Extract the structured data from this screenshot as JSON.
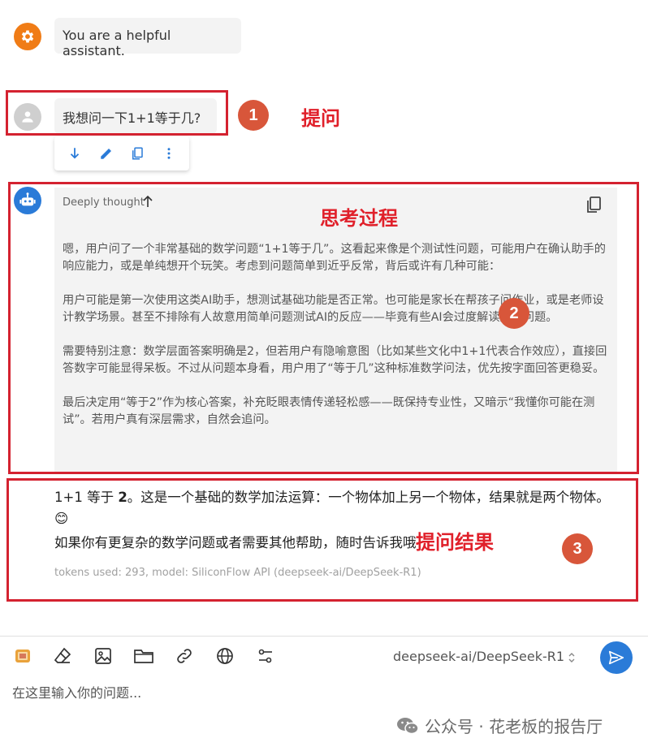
{
  "system_message": {
    "text": "You are a helpful assistant."
  },
  "user_message": {
    "text": "我想问一下1+1等于几?"
  },
  "annotations": {
    "num1": "1",
    "label1": "提问",
    "num2": "2",
    "label2": "思考过程",
    "num3": "3",
    "label3": "提问结果",
    "accent": "#d42230"
  },
  "message_toolbar": {
    "icons": [
      "arrow-down-icon",
      "pencil-icon",
      "copy-icon",
      "more-vert-icon"
    ]
  },
  "thinking": {
    "header": "Deeply thought",
    "paragraphs": [
      "嗯，用户问了一个非常基础的数学问题“1+1等于几”。这看起来像是个测试性问题，可能用户在确认助手的响应能力，或是单纯想开个玩笑。考虑到问题简单到近乎反常，背后或许有几种可能：",
      "用户可能是第一次使用这类AI助手，想测试基础功能是否正常。也可能是家长在帮孩子问作业，或是老师设计教学场景。甚至不排除有人故意用简单问题测试AI的反应——毕竟有些AI会过度解读这种问题。",
      "需要特别注意：数学层面答案明确是2，但若用户有隐喻意图（比如某些文化中1+1代表合作效应），直接回答数字可能显得呆板。不过从问题本身看，用户用了“等于几”这种标准数学问法，优先按字面回答更稳妥。",
      "最后决定用“等于2”作为核心答案，补充眨眼表情传递轻松感——既保持专业性，又暗示“我懂你可能在测试”。若用户真有深层需求，自然会追问。"
    ]
  },
  "answer": {
    "line1_prefix": "1+1 等于 ",
    "line1_bold": "2",
    "line1_suffix": "。这是一个基础的数学加法运算：一个物体加上另一个物体，结果就是两个物体。😊",
    "line2": "如果你有更复杂的数学问题或者需要其他帮助，随时告诉我哦！",
    "tokens": "tokens used: 293, model: SiliconFlow API (deepseek-ai/DeepSeek-R1)"
  },
  "input_bar": {
    "tool_icons": [
      "app-icon",
      "eraser-icon",
      "image-icon",
      "folder-icon",
      "link-icon",
      "globe-icon",
      "settings-sliders-icon"
    ],
    "model": "deepseek-ai/DeepSeek-R1",
    "placeholder": "在这里输入你的问题...",
    "send_icon": "send-icon"
  },
  "watermark": {
    "text": "公众号 · 花老板的报告厅"
  },
  "colors": {
    "primary": "#2a7bd8",
    "system_avatar": "#f07c16",
    "bubble": "#f3f3f3"
  }
}
